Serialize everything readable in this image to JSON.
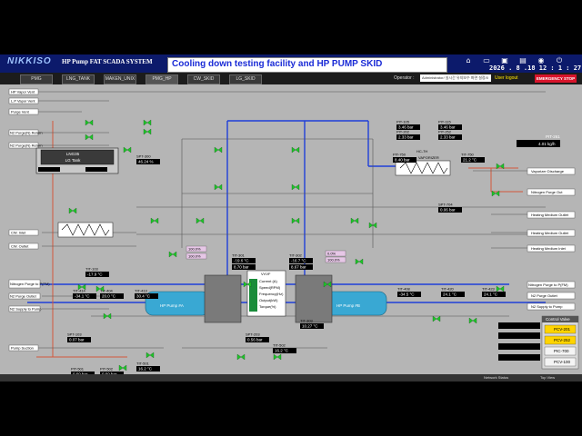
{
  "header": {
    "logo": "NIKKISO",
    "system_title": "HP Pump FAT SCADA SYSTEM",
    "banner": "Cooling down testing facility and HP PUMP SKID",
    "datetime": "2026 . 8 .18   12 : 1 : 27"
  },
  "tabs": [
    {
      "label": "PMG"
    },
    {
      "label": "LNG_TANK"
    },
    {
      "label": "MAKEN_UNIX"
    },
    {
      "label": "PMG_HP"
    },
    {
      "label": "CW_SKID"
    },
    {
      "label": "LG_SKID"
    }
  ],
  "operator": {
    "label": "Operator :",
    "value": "Administrator/ 실시간 유지보수 화면 설정/0",
    "login": "User logout",
    "estop": "EMERGENCY STOP"
  },
  "left_tags": [
    {
      "label": "HP Vapor Vent"
    },
    {
      "label": "L.P Vapor Vent"
    },
    {
      "label": "Purge Vent"
    },
    {
      "label": "N2 Purge(N) Return"
    },
    {
      "label": "N2 Purge(N) Return"
    },
    {
      "label": "CW. Inlet"
    },
    {
      "label": "CW. Outlet"
    },
    {
      "label": "Nitrogen Purge to P(FM)"
    },
    {
      "label": "N2 Purge Outlet"
    },
    {
      "label": "N2 Supply to Pump"
    },
    {
      "label": "Pump Suction"
    }
  ],
  "right_tags": [
    {
      "label": "Vaporizer Discharge"
    },
    {
      "label": "Nitrogen Purge Out"
    },
    {
      "label": "Heating Medium Outlet"
    },
    {
      "label": "Heating Medium Outlet"
    },
    {
      "label": "Heating Medium Inlet"
    },
    {
      "label": "Nitrogen Purge to P(FM)"
    },
    {
      "label": "N2 Purge Outlet"
    },
    {
      "label": "N2 Supply to Pump"
    }
  ],
  "tank": {
    "label": "LNG35",
    "sub": "LG Tank"
  },
  "vaporizer": {
    "label": "VAPORIZER",
    "tag": "HC-7H"
  },
  "pump_a": {
    "label": "HP Pump #A"
  },
  "pump_b": {
    "label": "HP Pump #B"
  },
  "readings": [
    {
      "tag": "PIT-105",
      "value": "3.46 bar"
    },
    {
      "tag": "PIT-115",
      "value": "3.46 bar"
    },
    {
      "tag": "PIT-202",
      "value": "2.33 bar"
    },
    {
      "tag": "PIT-252",
      "value": "2.33 bar"
    },
    {
      "tag": "PIT-261",
      "value": "4.01 kg/h"
    },
    {
      "tag": "PIT-750",
      "value": "8.40 bar"
    },
    {
      "tag": "TIT-750",
      "value": "21.2 °C"
    },
    {
      "tag": "SPT-300",
      "value": "46.24 %"
    },
    {
      "tag": "SPT-704",
      "value": "0.06 bar"
    },
    {
      "tag": "TIT-301",
      "value": "-19.6 °C"
    },
    {
      "tag": "PIT-301",
      "value": "8.70 bar"
    },
    {
      "tag": "TIT-302",
      "value": "-16.7 °C"
    },
    {
      "tag": "PIT-302",
      "value": "8.67 bar"
    },
    {
      "tag": "TIT-303",
      "value": "10.27 °C"
    },
    {
      "tag": "TIT-103",
      "value": "-17.9 °C"
    },
    {
      "tag": "TIT-404",
      "value": "20.0 °C"
    },
    {
      "tag": "TIT-413",
      "value": "30.4 °C"
    },
    {
      "tag": "TIT-414",
      "value": "-34.1 °C"
    },
    {
      "tag": "TIT-408",
      "value": "-34.5 °C"
    },
    {
      "tag": "TIT-420",
      "value": "24.1 °C"
    },
    {
      "tag": "TIT-423",
      "value": "24.1 °C"
    },
    {
      "tag": "SPT-103",
      "value": "0.07 bar"
    },
    {
      "tag": "SPT-203",
      "value": "0.56 bar"
    },
    {
      "tag": "PIT-501",
      "value": "0.60 bar"
    },
    {
      "tag": "PIT-502",
      "value": "0.60 bar"
    },
    {
      "tag": "TIT-501",
      "value": "16.2 °C"
    },
    {
      "tag": "TIT-502",
      "value": "16.2 °C"
    }
  ],
  "valve_pct": [
    {
      "value": "100.0%"
    },
    {
      "value": "100.0%"
    },
    {
      "value": "0.0%"
    },
    {
      "value": "100.0%"
    }
  ],
  "vfd_panel": {
    "title": "VVVF",
    "rows": [
      "Current (A)",
      "Speed(RPM)",
      "Frequency(Hz)",
      "Output(kW)",
      "Torque(%)"
    ]
  },
  "control_valve": {
    "title": "Control Valve",
    "buttons": [
      {
        "label": "PCV-201",
        "active": true
      },
      {
        "label": "PCV-252",
        "active": true
      },
      {
        "label": "PIC-700",
        "active": false
      },
      {
        "label": "PCV-100",
        "active": false
      }
    ]
  },
  "status_rows": [
    {
      "value": ""
    },
    {
      "value": ""
    },
    {
      "value": ""
    },
    {
      "value": ""
    }
  ],
  "footer": {
    "network": "Network Status",
    "view": "Top View"
  },
  "colors": {
    "canvas": "#b5b5b5",
    "lng_line": "#1f3fd9",
    "hot_line": "#d3583b",
    "valve_green": "#1fc42a",
    "readout_bg": "#000000",
    "pump_body": "#39a8d3"
  }
}
